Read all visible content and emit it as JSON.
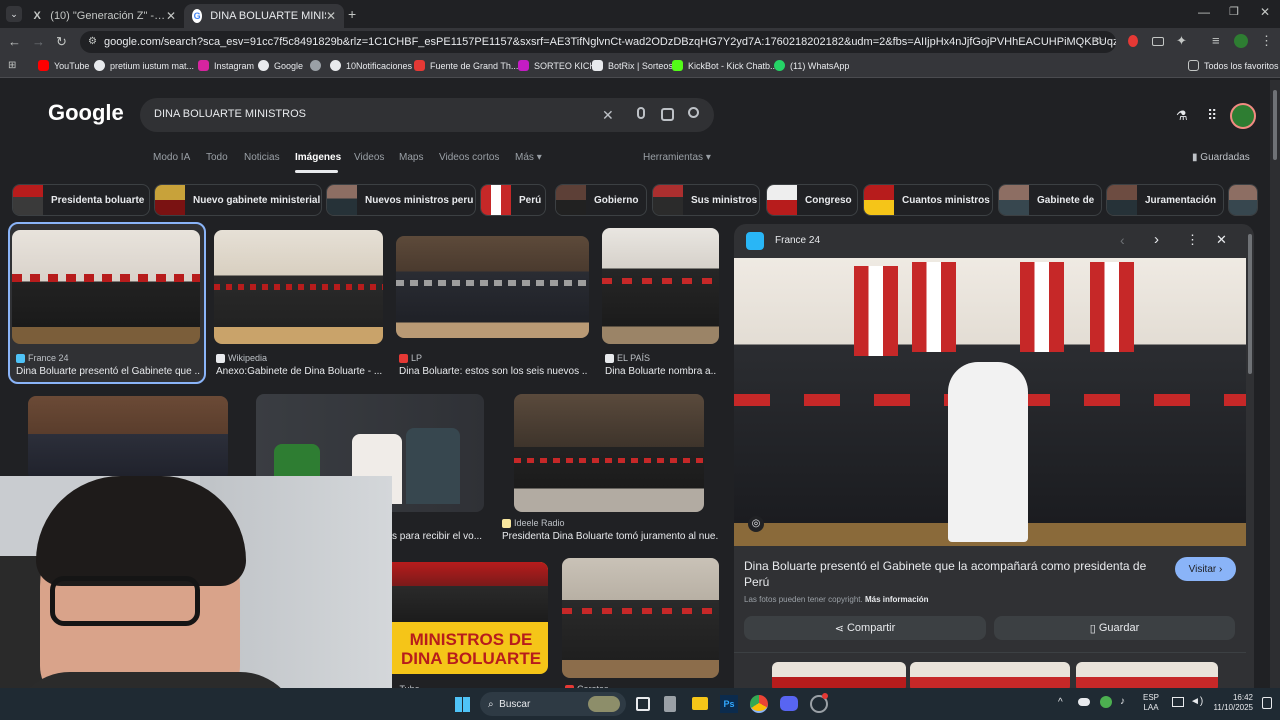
{
  "tabs": [
    {
      "title": "(10) \"Generación Z\" - Buscar / X",
      "icon": "x-icon"
    },
    {
      "title": "DINA BOLUARTE MINISTROS - ",
      "icon": "google-icon"
    }
  ],
  "url": "google.com/search?sca_esv=91cc7f5c8491829b&rlz=1C1CHBF_esPE1157PE1157&sxsrf=AE3TifNglvnCt-wad2ODzDBzqHG7Y2yd7A:1760218202182&udm=2&fbs=AIIjpHx4nJjfGojPVHhEACUHPiMQKBUqzTkgNGGtr-5xqnF46iLlSSEy8rWXEv...",
  "bookmarks": [
    {
      "label": "YouTube",
      "color": "#ff0000"
    },
    {
      "label": "pretium iustum mat...",
      "color": "#e8eaed"
    },
    {
      "label": "Instagram",
      "color": "#d6249f"
    },
    {
      "label": "Google",
      "color": "#e8eaed"
    },
    {
      "label": "",
      "color": "#9aa0a6"
    },
    {
      "label": "10Notificaciones",
      "color": "#e8eaed"
    },
    {
      "label": "Fuente de Grand Th...",
      "color": "#e53935"
    },
    {
      "label": "SORTEO KICK",
      "color": "#c41cc4"
    },
    {
      "label": "BotRix | Sorteos",
      "color": "#e8eaed"
    },
    {
      "label": "KickBot - Kick Chatb...",
      "color": "#53fc18"
    },
    {
      "label": "(11) WhatsApp",
      "color": "#25d366"
    }
  ],
  "bookmarks_all": "Todos los favoritos",
  "google": {
    "logo": "Google",
    "query": "DINA BOLUARTE MINISTROS",
    "saved": "Guardadas"
  },
  "nav_tabs": [
    "Modo IA",
    "Todo",
    "Noticias",
    "Imágenes",
    "Videos",
    "Maps",
    "Videos cortos",
    "Más",
    "Herramientas"
  ],
  "chips": [
    "Presidenta boluarte",
    "Nuevo gabinete ministerial",
    "Nuevos ministros peru",
    "Perú",
    "Gobierno",
    "Sus ministros",
    "Congreso",
    "Cuantos ministros",
    "Gabinete de",
    "Juramentación"
  ],
  "results": [
    {
      "source": "France 24",
      "title": "Dina Boluarte presentó el Gabinete que ..."
    },
    {
      "source": "Wikipedia",
      "title": "Anexo:Gabinete de Dina Boluarte - ..."
    },
    {
      "source": "LP",
      "title": "Dina Boluarte: estos son los seis nuevos ..."
    },
    {
      "source": "EL PAÍS",
      "title": "Dina Boluarte nombra a..."
    },
    {
      "source": "",
      "title": "s para recibir el vo..."
    },
    {
      "source": "Ideele Radio",
      "title": "Presidenta Dina Boluarte tomó juramento al nue..."
    },
    {
      "source": "",
      "title": "MINISTROS DE\nDINA BOLUARTE"
    },
    {
      "source": "...Tube",
      "title": ""
    },
    {
      "source": "Caretas",
      "title": ""
    }
  ],
  "thumb_overlay": {
    "line1": "MINISTROS DE",
    "line2": "DINA BOLUARTE"
  },
  "panel": {
    "source": "France 24",
    "title": "Dina Boluarte presentó el Gabinete que la acompañará como presidenta de Perú",
    "visit": "Visitar",
    "copyright": "Las fotos pueden tener copyright.",
    "more_info": "Más información",
    "share": "Compartir",
    "save": "Guardar"
  },
  "taskbar": {
    "search": "Buscar",
    "lang1": "ESP",
    "lang2": "LAA",
    "time": "16:42",
    "date": "11/10/2025"
  }
}
